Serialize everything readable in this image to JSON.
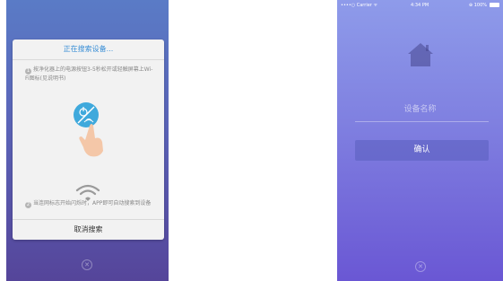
{
  "left_screen": {
    "dialog_title": "正在搜索设备...",
    "steps": [
      {
        "num": "1",
        "text": "按净化器上的电源按钮3-5秒松开或轻触屏幕上Wi-Fi图标(见说明书)"
      },
      {
        "num": "2",
        "text": "当连网标志开始闪烁时，APP即可自动搜索到设备"
      }
    ],
    "cancel_label": "取消搜索",
    "close_glyph": "✕"
  },
  "right_screen": {
    "status": {
      "carrier": "••••○ Carrier ᯤ",
      "time": "4:34 PM",
      "battery": "⊕ 100%"
    },
    "device_name_label": "设备名称",
    "confirm_label": "确认",
    "close_glyph": "✕"
  },
  "colors": {
    "left_bg_top": "#5a7bc6",
    "left_bg_bottom": "#55459a",
    "right_bg_top": "#8e9bea",
    "right_bg_bottom": "#6a57d4",
    "accent_blue": "#3a8fd6"
  },
  "icons": [
    "hand-tap-icon",
    "wifi-icon",
    "home-icon",
    "close-icon"
  ]
}
